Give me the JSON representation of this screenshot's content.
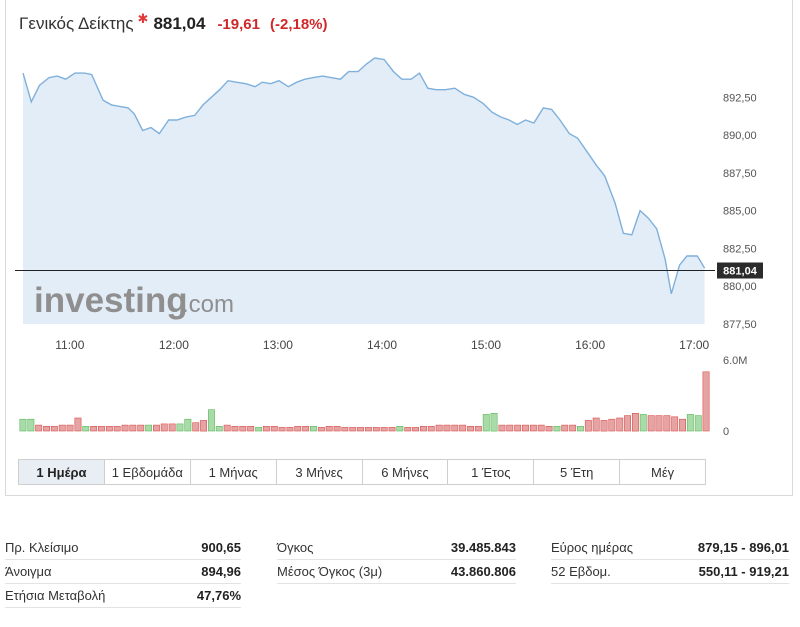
{
  "header": {
    "name": "Γενικός Δείκτης",
    "last": "881,04",
    "change": "-19,61",
    "change_pct": "(-2,18%)"
  },
  "watermark": {
    "brand": "investing",
    "suffix": ".com"
  },
  "colors": {
    "line": "#7fb0dc",
    "fill": "#e3edf7",
    "down": "#d9534f",
    "down_fill": "#e6a3a3",
    "up": "#5cb85c",
    "up_fill": "#a9dba9"
  },
  "chart_data": [
    {
      "type": "area",
      "title": "",
      "x_ticks": [
        "11:00",
        "12:00",
        "13:00",
        "14:00",
        "15:00",
        "16:00",
        "17:00"
      ],
      "y_ticks": [
        "892,50",
        "890,00",
        "887,50",
        "885,00",
        "882,50",
        "880,00",
        "877,50"
      ],
      "ylim": [
        877.5,
        895.1
      ],
      "xlim_hours": [
        10.55,
        17.2
      ],
      "last_value_label": "881,04",
      "reference_level": 881.04,
      "grid": false,
      "series": [
        {
          "values": [
            [
              10.55,
              894.1
            ],
            [
              10.63,
              892.2
            ],
            [
              10.71,
              893.3
            ],
            [
              10.8,
              893.8
            ],
            [
              10.88,
              893.9
            ],
            [
              10.96,
              893.7
            ],
            [
              11.05,
              894.1
            ],
            [
              11.14,
              894.1
            ],
            [
              11.21,
              894.0
            ],
            [
              11.32,
              892.3
            ],
            [
              11.4,
              892.0
            ],
            [
              11.48,
              891.9
            ],
            [
              11.56,
              891.8
            ],
            [
              11.62,
              891.4
            ],
            [
              11.7,
              890.3
            ],
            [
              11.78,
              890.5
            ],
            [
              11.86,
              890.1
            ],
            [
              11.95,
              891.0
            ],
            [
              12.03,
              891.0
            ],
            [
              12.12,
              891.2
            ],
            [
              12.2,
              891.3
            ],
            [
              12.28,
              892.0
            ],
            [
              12.36,
              892.5
            ],
            [
              12.44,
              893.0
            ],
            [
              12.52,
              893.6
            ],
            [
              12.6,
              893.5
            ],
            [
              12.69,
              893.4
            ],
            [
              12.78,
              893.2
            ],
            [
              12.85,
              893.5
            ],
            [
              12.93,
              893.4
            ],
            [
              13.01,
              893.6
            ],
            [
              13.1,
              893.2
            ],
            [
              13.18,
              893.5
            ],
            [
              13.26,
              893.7
            ],
            [
              13.34,
              893.8
            ],
            [
              13.43,
              893.9
            ],
            [
              13.51,
              893.8
            ],
            [
              13.6,
              893.7
            ],
            [
              13.68,
              894.2
            ],
            [
              13.77,
              894.2
            ],
            [
              13.85,
              894.7
            ],
            [
              13.93,
              895.1
            ],
            [
              14.02,
              895.0
            ],
            [
              14.11,
              894.2
            ],
            [
              14.19,
              893.7
            ],
            [
              14.28,
              893.7
            ],
            [
              14.36,
              894.1
            ],
            [
              14.44,
              893.1
            ],
            [
              14.52,
              893.0
            ],
            [
              14.61,
              893.0
            ],
            [
              14.7,
              893.1
            ],
            [
              14.79,
              892.7
            ],
            [
              14.88,
              892.5
            ],
            [
              14.97,
              892.1
            ],
            [
              15.06,
              891.5
            ],
            [
              15.14,
              891.2
            ],
            [
              15.22,
              891.0
            ],
            [
              15.3,
              890.7
            ],
            [
              15.38,
              891.0
            ],
            [
              15.46,
              890.8
            ],
            [
              15.55,
              891.8
            ],
            [
              15.63,
              891.7
            ],
            [
              15.71,
              891.0
            ],
            [
              15.8,
              890.1
            ],
            [
              15.88,
              889.8
            ],
            [
              15.96,
              889.0
            ],
            [
              16.06,
              888.0
            ],
            [
              16.14,
              887.3
            ],
            [
              16.24,
              885.5
            ],
            [
              16.32,
              883.5
            ],
            [
              16.4,
              883.4
            ],
            [
              16.48,
              885.0
            ],
            [
              16.56,
              884.5
            ],
            [
              16.64,
              883.8
            ],
            [
              16.72,
              881.8
            ],
            [
              16.78,
              879.5
            ],
            [
              16.86,
              881.4
            ],
            [
              16.93,
              882.0
            ],
            [
              17.03,
              882.0
            ],
            [
              17.1,
              881.2
            ]
          ]
        }
      ]
    },
    {
      "type": "bar",
      "title": "",
      "y_ticks": [
        "6.0M",
        "0"
      ],
      "ylim": [
        0,
        6000000
      ],
      "bars": [
        {
          "v": 1000000,
          "dir": "up"
        },
        {
          "v": 1000000,
          "dir": "up"
        },
        {
          "v": 500000,
          "dir": "down"
        },
        {
          "v": 400000,
          "dir": "down"
        },
        {
          "v": 400000,
          "dir": "down"
        },
        {
          "v": 500000,
          "dir": "down"
        },
        {
          "v": 500000,
          "dir": "down"
        },
        {
          "v": 1100000,
          "dir": "down"
        },
        {
          "v": 400000,
          "dir": "up"
        },
        {
          "v": 400000,
          "dir": "down"
        },
        {
          "v": 400000,
          "dir": "down"
        },
        {
          "v": 400000,
          "dir": "down"
        },
        {
          "v": 400000,
          "dir": "down"
        },
        {
          "v": 500000,
          "dir": "down"
        },
        {
          "v": 500000,
          "dir": "down"
        },
        {
          "v": 500000,
          "dir": "down"
        },
        {
          "v": 500000,
          "dir": "up"
        },
        {
          "v": 500000,
          "dir": "down"
        },
        {
          "v": 600000,
          "dir": "down"
        },
        {
          "v": 600000,
          "dir": "down"
        },
        {
          "v": 600000,
          "dir": "up"
        },
        {
          "v": 1000000,
          "dir": "up"
        },
        {
          "v": 700000,
          "dir": "down"
        },
        {
          "v": 900000,
          "dir": "down"
        },
        {
          "v": 1800000,
          "dir": "up"
        },
        {
          "v": 400000,
          "dir": "up"
        },
        {
          "v": 500000,
          "dir": "down"
        },
        {
          "v": 400000,
          "dir": "down"
        },
        {
          "v": 400000,
          "dir": "down"
        },
        {
          "v": 400000,
          "dir": "down"
        },
        {
          "v": 300000,
          "dir": "up"
        },
        {
          "v": 400000,
          "dir": "down"
        },
        {
          "v": 400000,
          "dir": "down"
        },
        {
          "v": 300000,
          "dir": "down"
        },
        {
          "v": 300000,
          "dir": "down"
        },
        {
          "v": 400000,
          "dir": "down"
        },
        {
          "v": 400000,
          "dir": "down"
        },
        {
          "v": 400000,
          "dir": "up"
        },
        {
          "v": 300000,
          "dir": "down"
        },
        {
          "v": 400000,
          "dir": "down"
        },
        {
          "v": 400000,
          "dir": "down"
        },
        {
          "v": 300000,
          "dir": "down"
        },
        {
          "v": 300000,
          "dir": "down"
        },
        {
          "v": 300000,
          "dir": "down"
        },
        {
          "v": 300000,
          "dir": "down"
        },
        {
          "v": 300000,
          "dir": "down"
        },
        {
          "v": 300000,
          "dir": "down"
        },
        {
          "v": 300000,
          "dir": "down"
        },
        {
          "v": 400000,
          "dir": "up"
        },
        {
          "v": 300000,
          "dir": "down"
        },
        {
          "v": 300000,
          "dir": "down"
        },
        {
          "v": 400000,
          "dir": "down"
        },
        {
          "v": 400000,
          "dir": "down"
        },
        {
          "v": 500000,
          "dir": "down"
        },
        {
          "v": 500000,
          "dir": "down"
        },
        {
          "v": 500000,
          "dir": "down"
        },
        {
          "v": 500000,
          "dir": "down"
        },
        {
          "v": 400000,
          "dir": "down"
        },
        {
          "v": 400000,
          "dir": "down"
        },
        {
          "v": 1400000,
          "dir": "up"
        },
        {
          "v": 1500000,
          "dir": "up"
        },
        {
          "v": 500000,
          "dir": "down"
        },
        {
          "v": 500000,
          "dir": "down"
        },
        {
          "v": 500000,
          "dir": "down"
        },
        {
          "v": 500000,
          "dir": "down"
        },
        {
          "v": 500000,
          "dir": "down"
        },
        {
          "v": 500000,
          "dir": "down"
        },
        {
          "v": 400000,
          "dir": "down"
        },
        {
          "v": 400000,
          "dir": "up"
        },
        {
          "v": 500000,
          "dir": "down"
        },
        {
          "v": 500000,
          "dir": "down"
        },
        {
          "v": 400000,
          "dir": "up"
        },
        {
          "v": 900000,
          "dir": "down"
        },
        {
          "v": 1100000,
          "dir": "down"
        },
        {
          "v": 900000,
          "dir": "down"
        },
        {
          "v": 1000000,
          "dir": "down"
        },
        {
          "v": 1100000,
          "dir": "down"
        },
        {
          "v": 1300000,
          "dir": "down"
        },
        {
          "v": 1500000,
          "dir": "down"
        },
        {
          "v": 1400000,
          "dir": "up"
        },
        {
          "v": 1300000,
          "dir": "down"
        },
        {
          "v": 1300000,
          "dir": "down"
        },
        {
          "v": 1300000,
          "dir": "down"
        },
        {
          "v": 1200000,
          "dir": "down"
        },
        {
          "v": 1000000,
          "dir": "down"
        },
        {
          "v": 1400000,
          "dir": "up"
        },
        {
          "v": 1300000,
          "dir": "up"
        },
        {
          "v": 5000000,
          "dir": "down"
        }
      ]
    }
  ],
  "tabs": [
    {
      "label": "1 Ημέρα",
      "active": true
    },
    {
      "label": "1 Εβδομάδα",
      "active": false
    },
    {
      "label": "1 Μήνας",
      "active": false
    },
    {
      "label": "3 Μήνες",
      "active": false
    },
    {
      "label": "6 Μήνες",
      "active": false
    },
    {
      "label": "1 Έτος",
      "active": false
    },
    {
      "label": "5 Έτη",
      "active": false
    },
    {
      "label": "Μέγ",
      "active": false
    }
  ],
  "stats": {
    "col1": [
      {
        "label": "Πρ. Κλείσιμο",
        "value": "900,65"
      },
      {
        "label": "Άνοιγμα",
        "value": "894,96"
      },
      {
        "label": "Ετήσια Μεταβολή",
        "value": "47,76%"
      }
    ],
    "col2": [
      {
        "label": "Όγκος",
        "value": "39.485.843"
      },
      {
        "label": "Μέσος Όγκος (3μ)",
        "value": "43.860.806"
      }
    ],
    "col3": [
      {
        "label": "Εύρος ημέρας",
        "value": "879,15 - 896,01"
      },
      {
        "label": "52 Εβδομ.",
        "value": "550,11 - 919,21"
      }
    ]
  }
}
